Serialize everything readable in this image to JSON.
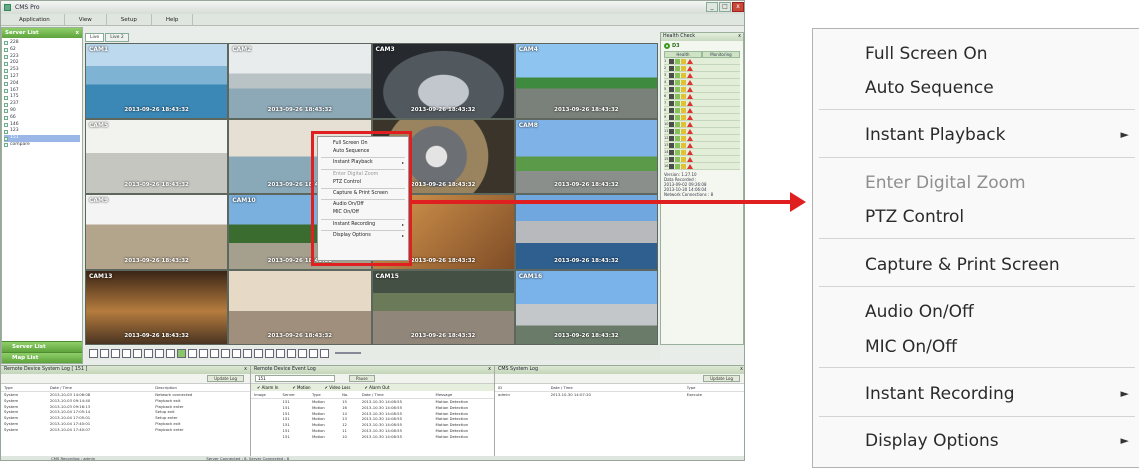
{
  "window": {
    "title": "CMS Pro",
    "buttons": [
      "_",
      "□",
      "x"
    ]
  },
  "menu": [
    "Application",
    "View",
    "Setup",
    "Help"
  ],
  "server_list": {
    "title": "Server List",
    "close": "x",
    "items": [
      "228",
      "62",
      "223",
      "202",
      "253",
      "127",
      "204",
      "167",
      "175",
      "237",
      "90",
      "66",
      "146",
      "123",
      "151",
      "compare"
    ],
    "selected_index": 14
  },
  "left_bottom": {
    "server_list": "Server List",
    "map_list": "Map List"
  },
  "view_tabs": [
    "Live",
    "Live 2"
  ],
  "cameras": [
    {
      "label": "CAM1",
      "time": "2013-09-26  18:43:32"
    },
    {
      "label": "CAM2",
      "time": "2013-09-26  18:43:32"
    },
    {
      "label": "CAM3",
      "time": "2013-09-26  18:43:32"
    },
    {
      "label": "CAM4",
      "time": "2013-09-26  18:43:32"
    },
    {
      "label": "CAM5",
      "time": "2013-09-26  18:43:32"
    },
    {
      "label": "",
      "time": "2013-09-26  18:43:32"
    },
    {
      "label": "",
      "time": "2013-09-26  18:43:32"
    },
    {
      "label": "CAM8",
      "time": "2013-09-26  18:43:32"
    },
    {
      "label": "CAM9",
      "time": "2013-09-26  18:43:32"
    },
    {
      "label": "CAM10",
      "time": "2013-09-26  18:43:32"
    },
    {
      "label": "",
      "time": "2013-09-26  18:43:32"
    },
    {
      "label": "",
      "time": "2013-09-26  18:43:32"
    },
    {
      "label": "CAM13",
      "time": "2013-09-26  18:43:32"
    },
    {
      "label": "",
      "time": "2013-09-26  18:43:32"
    },
    {
      "label": "CAM15",
      "time": "2013-09-26  18:43:32"
    },
    {
      "label": "CAM16",
      "time": "2013-09-26  18:43:32"
    }
  ],
  "context_menu_small": [
    "Full Screen On",
    "Auto Sequence",
    "Instant Playback",
    "Enter Digital Zoom",
    "PTZ Control",
    "Capture & Print Screen",
    "Audio On/Off",
    "MIC On/Off",
    "Instant Recording",
    "Display Options"
  ],
  "context_menu": {
    "full_screen": "Full Screen On",
    "auto_sequence": "Auto Sequence",
    "instant_playback": "Instant Playback",
    "digital_zoom": "Enter Digital Zoom",
    "ptz": "PTZ Control",
    "capture": "Capture & Print Screen",
    "audio": "Audio On/Off",
    "mic": "MIC On/Off",
    "instant_recording": "Instant Recording",
    "display_options": "Display Options",
    "submenu_arrow": "►"
  },
  "health": {
    "title": "Health Check",
    "close": "x",
    "server": "D3",
    "columns": [
      "Health",
      "Monitoring"
    ],
    "version": "Version:    1.27.10",
    "data_recorded_label": "Data Recorded :",
    "data_recorded_1": "2013-09-02 09:26:08",
    "data_recorded_2": "2013-10-30 14:06:04",
    "network": "Network Connections : 8"
  },
  "bottom": {
    "device_log": {
      "title": "Remote Device System Log [ 151 ]",
      "button": "Update Log",
      "headers": [
        "Type",
        "Date / Time",
        "Description"
      ],
      "rows": [
        [
          "System",
          "2013-10-03 14:06:08",
          "Network connected"
        ],
        [
          "System",
          "2013-10-03 09:14:40",
          "Playback exit"
        ],
        [
          "System",
          "2013-10-03 09:16:13",
          "Playback enter"
        ],
        [
          "System",
          "2013-10-04 17:05:14",
          "Setup exit"
        ],
        [
          "System",
          "2013-10-04 17:05:01",
          "Setup enter"
        ],
        [
          "System",
          "2013-10-04 17:40:01",
          "Playback exit"
        ],
        [
          "System",
          "2013-10-04 17:40:07",
          "Playback enter"
        ]
      ]
    },
    "event_log": {
      "title": "Remote Device Event Log",
      "server": "151",
      "button": "Pause",
      "filters": [
        "Alarm In",
        "Motion",
        "Video Loss",
        "Alarm Out"
      ],
      "headers": [
        "Image",
        "Server",
        "Type",
        "No.",
        "Date / Time",
        "Message"
      ],
      "rows": [
        [
          "",
          "151",
          "Motion",
          "15",
          "2013-10-30 14:08:55",
          "Motion Detection"
        ],
        [
          "",
          "151",
          "Motion",
          "16",
          "2013-10-30 14:08:55",
          "Motion Detection"
        ],
        [
          "",
          "151",
          "Motion",
          "14",
          "2013-10-30 14:08:55",
          "Motion Detection"
        ],
        [
          "",
          "151",
          "Motion",
          "13",
          "2013-10-30 14:08:55",
          "Motion Detection"
        ],
        [
          "",
          "151",
          "Motion",
          "12",
          "2013-10-30 14:08:55",
          "Motion Detection"
        ],
        [
          "",
          "151",
          "Motion",
          "11",
          "2013-10-30 14:08:55",
          "Motion Detection"
        ],
        [
          "",
          "151",
          "Motion",
          "10",
          "2013-10-30 14:08:55",
          "Motion Detection"
        ]
      ]
    },
    "cms_log": {
      "title": "CMS System Log",
      "button": "Update Log",
      "headers": [
        "ID",
        "Date / Time",
        "Type"
      ],
      "rows": [
        [
          "admin",
          "2013-10-30 14:07:20",
          "Execute"
        ]
      ]
    },
    "status": [
      "CMS Recording : admin",
      "Server Connected : 8, Server Connected : 8"
    ]
  }
}
